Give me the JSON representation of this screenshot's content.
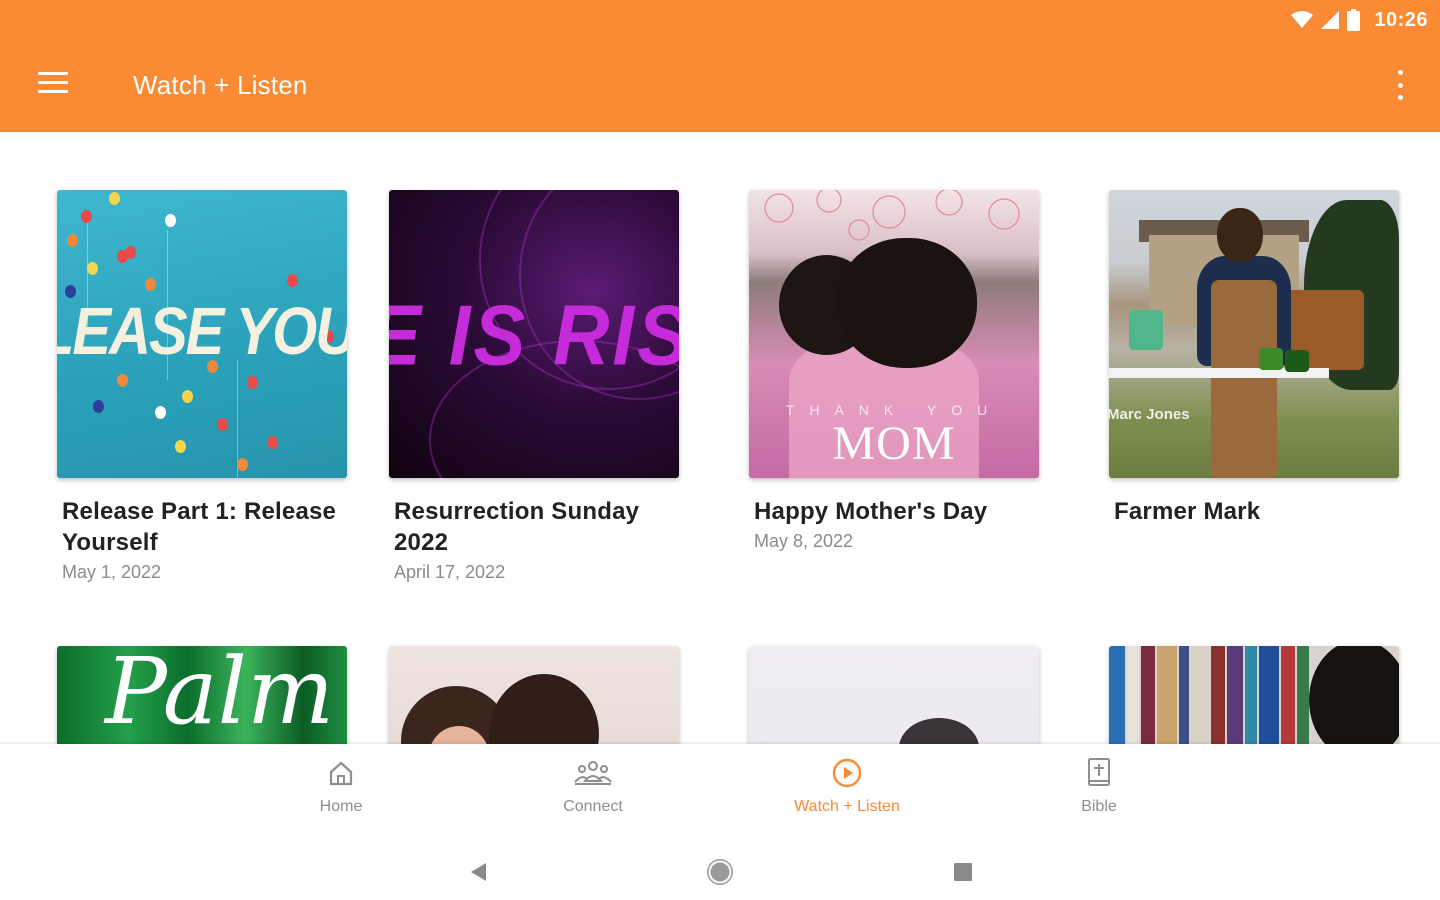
{
  "status_bar": {
    "time": "10:26",
    "icons": [
      "wifi-icon",
      "signal-icon",
      "battery-icon"
    ]
  },
  "app_bar": {
    "title": "Watch + Listen",
    "menu_icon": "menu-icon",
    "overflow_icon": "more-vert-icon",
    "color": "#FA8A33"
  },
  "cards": [
    {
      "title": "Release Part 1: Release Yourself",
      "date": "May 1, 2022",
      "art_text": "LEASE YOURS"
    },
    {
      "title": "Resurrection Sunday 2022",
      "date": "April 17, 2022",
      "art_text": "E IS RISE"
    },
    {
      "title": "Happy Mother's Day",
      "date": "May 8, 2022",
      "art_small": "THANK YOU",
      "art_text": "MOM"
    },
    {
      "title": "Farmer Mark",
      "date": "",
      "art_text": "Marc Jones"
    },
    {
      "title": "",
      "date": "",
      "art_text": "Palm"
    },
    {
      "title": "",
      "date": ""
    },
    {
      "title": "",
      "date": ""
    },
    {
      "title": "",
      "date": ""
    }
  ],
  "bottom_nav": [
    {
      "label": "Home",
      "icon": "home-icon",
      "active": false
    },
    {
      "label": "Connect",
      "icon": "people-icon",
      "active": false
    },
    {
      "label": "Watch + Listen",
      "icon": "play-circle-icon",
      "active": true
    },
    {
      "label": "Bible",
      "icon": "bible-icon",
      "active": false
    }
  ],
  "system_nav": {
    "back_icon": "back-icon",
    "home_icon": "home-circle-icon",
    "recents_icon": "recents-icon"
  },
  "colors": {
    "accent": "#FA8A33",
    "inactive": "#8E8E8E"
  }
}
